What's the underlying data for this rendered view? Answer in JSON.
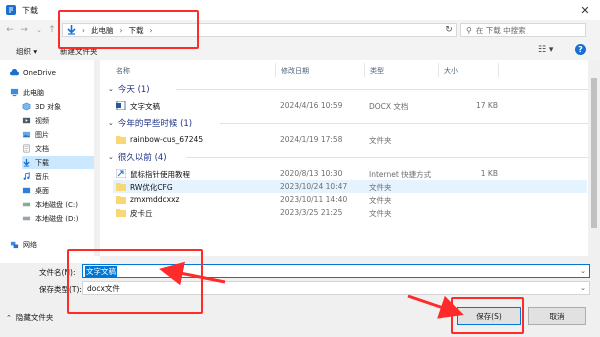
{
  "window": {
    "title": "下载",
    "close_glyph": "✕"
  },
  "address": {
    "segments": [
      "此电脑",
      "下载"
    ],
    "search_placeholder": "在 下载 中搜索"
  },
  "toolbar": {
    "organize_label": "组织 ▾",
    "new_folder_label": "新建文件夹"
  },
  "sidebar": {
    "items": [
      {
        "label": "OneDrive",
        "icon": "cloud-icon"
      },
      {
        "label": "此电脑",
        "icon": "computer-icon"
      },
      {
        "label": "3D 对象",
        "icon": "cube-icon"
      },
      {
        "label": "视频",
        "icon": "video-icon"
      },
      {
        "label": "图片",
        "icon": "picture-icon"
      },
      {
        "label": "文档",
        "icon": "document-icon"
      },
      {
        "label": "下载",
        "icon": "download-icon"
      },
      {
        "label": "音乐",
        "icon": "music-icon"
      },
      {
        "label": "桌面",
        "icon": "desktop-icon"
      },
      {
        "label": "本地磁盘 (C:)",
        "icon": "drive-icon"
      },
      {
        "label": "本地磁盘 (D:)",
        "icon": "drive-icon"
      },
      {
        "label": "网络",
        "icon": "network-icon"
      }
    ]
  },
  "columns": {
    "name": "名称",
    "date": "修改日期",
    "type": "类型",
    "size": "大小"
  },
  "groups": [
    {
      "label": "今天 (1)",
      "rows": [
        {
          "name": "文字文稿",
          "date": "2024/4/16 10:59",
          "type": "DOCX 文档",
          "size": "17 KB",
          "icon": "docx-icon"
        }
      ]
    },
    {
      "label": "今年的早些时候 (1)",
      "rows": [
        {
          "name": "rainbow-cus_67245",
          "date": "2024/1/19 17:58",
          "type": "文件夹",
          "size": "",
          "icon": "folder-icon"
        }
      ]
    },
    {
      "label": "很久以前 (4)",
      "rows": [
        {
          "name": "鼠标指针使用教程",
          "date": "2020/8/13 10:30",
          "type": "Internet 快捷方式",
          "size": "1 KB",
          "icon": "shortcut-icon"
        },
        {
          "name": "RW优化CFG",
          "date": "2023/10/24 10:47",
          "type": "文件夹",
          "size": "",
          "icon": "folder-icon"
        },
        {
          "name": "zmxmddcxxz",
          "date": "2023/10/11 14:40",
          "type": "文件夹",
          "size": "",
          "icon": "folder-icon"
        },
        {
          "name": "皮卡丘",
          "date": "2023/3/25 21:25",
          "type": "文件夹",
          "size": "",
          "icon": "folder-icon"
        }
      ]
    }
  ],
  "form": {
    "filename_label": "文件名(N):",
    "filename_value": "文字文稿",
    "filetype_label": "保存类型(T):",
    "filetype_value": "docx文件",
    "hide_folders_label": "隐藏文件夹",
    "save_label": "保存(S)",
    "cancel_label": "取消"
  },
  "colors": {
    "annotation": "#ff2a2a",
    "accent": "#0078d7",
    "group_header": "#1e3287"
  }
}
